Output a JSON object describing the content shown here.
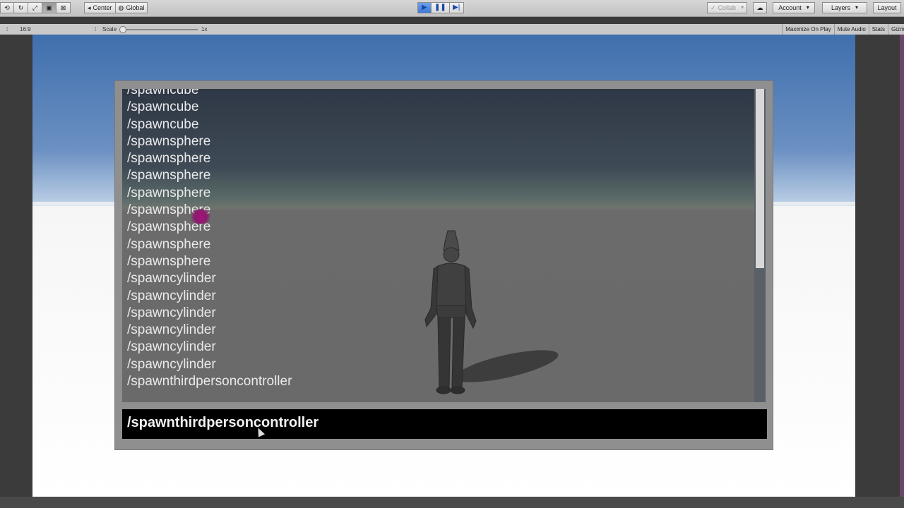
{
  "toolbar": {
    "transform_tools": [
      "hand-icon",
      "rotate-icon",
      "scale-icon",
      "rect-icon",
      "transform-icon"
    ],
    "pivot_label": "Center",
    "space_label": "Global",
    "collab_label": "Collab",
    "account_label": "Account",
    "layers_label": "Layers",
    "layout_label": "Layout"
  },
  "gamebar": {
    "aspect": "16:9",
    "scale_label": "Scale",
    "scale_value": "1x",
    "maximize_label": "Maximize On Play",
    "mute_label": "Mute Audio",
    "stats_label": "Stats",
    "gizmos_label": "Gizmos"
  },
  "console": {
    "log_lines": [
      "/spawncube",
      "/spawncube",
      "/spawncube",
      "/spawnsphere",
      "/spawnsphere",
      "/spawnsphere",
      "/spawnsphere",
      "/spawnsphere",
      "/spawnsphere",
      "/spawnsphere",
      "/spawnsphere",
      "/spawncylinder",
      "/spawncylinder",
      "/spawncylinder",
      "/spawncylinder",
      "/spawncylinder",
      "/spawncylinder",
      "/spawnthirdpersoncontroller"
    ],
    "input_value": "/spawnthirdpersoncontroller"
  }
}
